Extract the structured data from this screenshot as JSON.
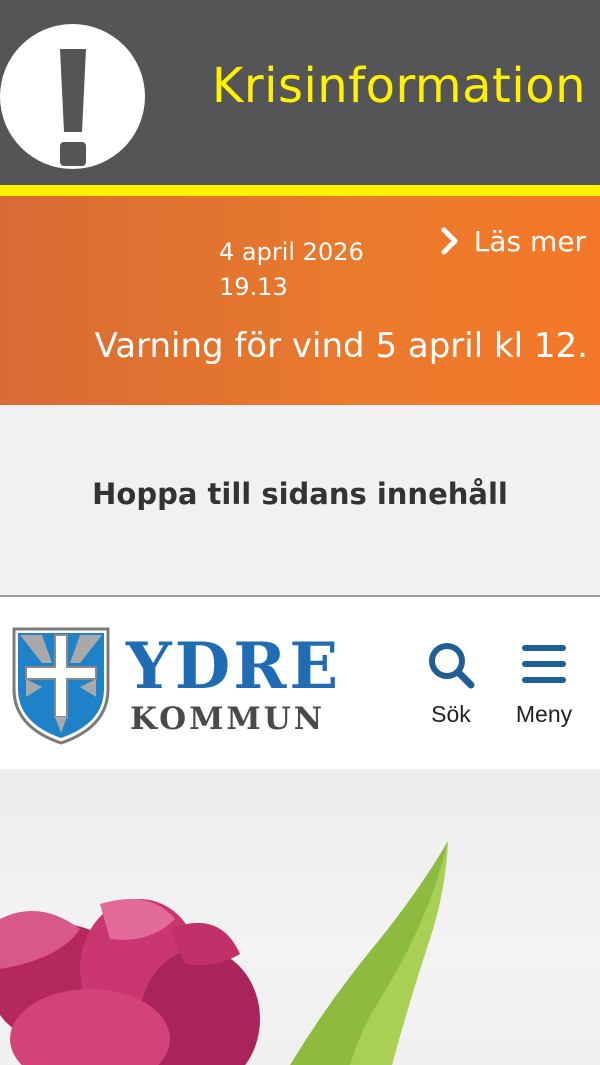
{
  "crisis": {
    "title": "Krisinformation",
    "icon": "exclamation-icon",
    "colors": {
      "background": "#555457",
      "accent": "#fff200"
    }
  },
  "warning": {
    "date": "4 april 2026",
    "time": "19.13",
    "read_more_label": "Läs mer",
    "read_more_icon": "chevron-right-icon",
    "message": "Varning för vind 5 april kl 12.",
    "color": "#ea7a2c"
  },
  "skip_link": {
    "label": "Hoppa till sidans innehåll"
  },
  "header": {
    "logo": {
      "name": "YDRE",
      "subtitle": "KOMMUN",
      "color": "#1f6cb5"
    },
    "search": {
      "label": "Sök",
      "icon": "search-icon"
    },
    "menu": {
      "label": "Meny",
      "icon": "hamburger-icon"
    }
  },
  "hero": {
    "image": "tulip-photo"
  }
}
